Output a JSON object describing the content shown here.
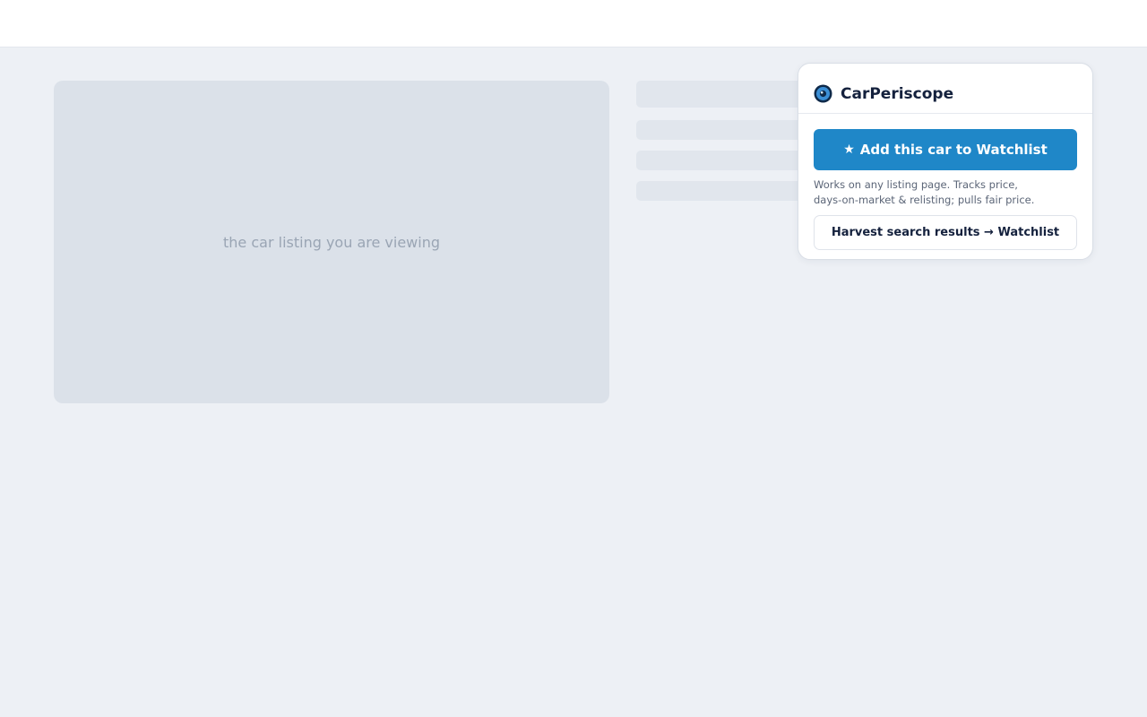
{
  "page": {
    "placeholder_image_text": "the car listing you are viewing"
  },
  "popup": {
    "brand_name": "CarPeriscope",
    "logo_icon": "periscope-eye-icon",
    "add_button": {
      "icon": "★",
      "label": "Add this car to Watchlist"
    },
    "helper_line1": "Works on any listing page. Tracks price,",
    "helper_line2": "days-on-market & relisting; pulls fair price.",
    "harvest_button_label": "Harvest search results → Watchlist"
  },
  "colors": {
    "accent": "#1f87c8",
    "brand_text": "#14213d",
    "page_background": "#edf0f5"
  }
}
